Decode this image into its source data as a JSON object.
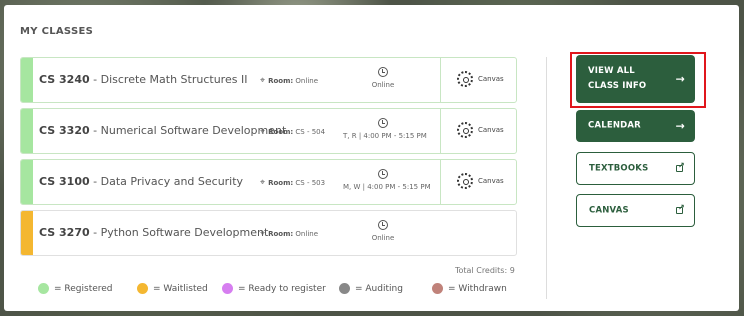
{
  "section_title": "MY CLASSES",
  "classes": [
    {
      "code": "CS 3240",
      "name": " - Discrete Math Structures II",
      "room_label": "Room:",
      "room": "Online",
      "time": "Online",
      "lms": "Canvas",
      "status": "registered"
    },
    {
      "code": "CS 3320",
      "name": " - Numerical Software Development",
      "room_label": "Room:",
      "room": "CS - 504",
      "time": "T, R | 4:00 PM - 5:15 PM",
      "lms": "Canvas",
      "status": "registered"
    },
    {
      "code": "CS 3100",
      "name": " - Data Privacy and Security",
      "room_label": "Room:",
      "room": "CS - 503",
      "time": "M, W | 4:00 PM - 5:15 PM",
      "lms": "Canvas",
      "status": "registered"
    },
    {
      "code": "CS 3270",
      "name": " - Python Software Development",
      "room_label": "Room:",
      "room": "Online",
      "time": "Online",
      "lms": "",
      "status": "waitlisted"
    }
  ],
  "total_credits": "Total Credits: 9",
  "legend": [
    {
      "label": "= Registered",
      "color": "#a6e6a0"
    },
    {
      "label": "= Waitlisted",
      "color": "#f4b731"
    },
    {
      "label": "= Ready to register",
      "color": "#d67ef0"
    },
    {
      "label": "= Auditing",
      "color": "#888888"
    },
    {
      "label": "= Withdrawn",
      "color": "#c0827a"
    }
  ],
  "buttons": {
    "view_all": "VIEW ALL CLASS INFO",
    "calendar": "CALENDAR",
    "textbooks": "TEXTBOOKS",
    "canvas": "CANVAS"
  },
  "colors": {
    "primary": "#2c5e3d",
    "registered": "#a6e6a0",
    "waitlisted": "#f4b731",
    "highlight": "#e0161c"
  },
  "icons": {
    "room": "map-pin-icon",
    "time": "clock-icon",
    "lms": "canvas-logo-icon",
    "arrow": "arrow-right-icon",
    "external": "external-link-icon"
  }
}
